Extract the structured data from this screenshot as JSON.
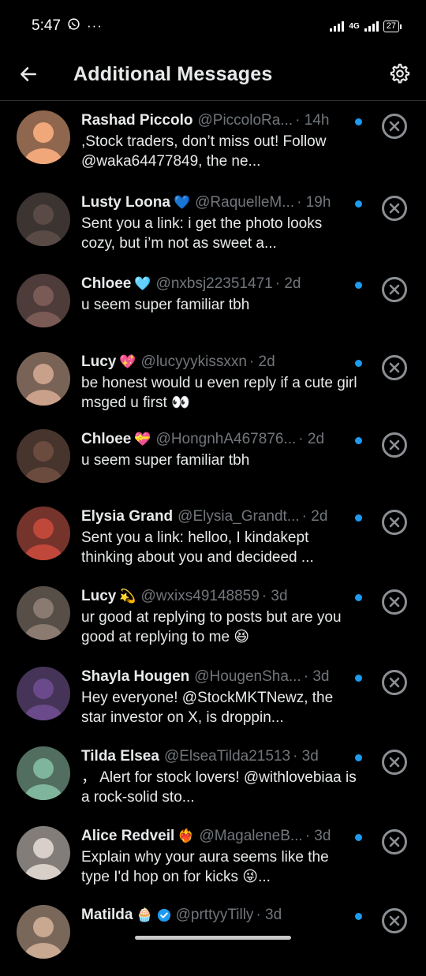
{
  "status_bar": {
    "time": "5:47",
    "network": "4G",
    "battery": "27"
  },
  "header": {
    "title": "Additional Messages"
  },
  "conversations": [
    {
      "name": "Rashad Piccolo",
      "emoji": "",
      "handle": "@PiccoloRa...",
      "time": "· 14h",
      "message": ",Stock traders, don’t miss out! Follow @waka64477849, the ne...",
      "avatar_color": "#f0a77a"
    },
    {
      "name": "Lusty Loona",
      "emoji": "💙",
      "handle": "@RaquelleM...",
      "time": "· 19h",
      "message": "Sent you a link: i get the photo looks cozy, but i’m not as sweet a...",
      "avatar_color": "#5a4a45"
    },
    {
      "name": "Chloee",
      "emoji": "🩵",
      "handle": "@nxbsj22351471",
      "time": "· 2d",
      "message": "u seem super familiar tbh",
      "avatar_color": "#7a5a55"
    },
    {
      "name": "Lucy",
      "emoji": "💖",
      "handle": "@lucyyykissxxn",
      "time": "· 2d",
      "message": "be honest would u even reply if a cute girl msged u first 👀",
      "avatar_color": "#c9a08a"
    },
    {
      "name": "Chloee",
      "emoji": "💝",
      "handle": "@HongnhA467876...",
      "time": "· 2d",
      "message": "u seem super familiar tbh",
      "avatar_color": "#6b4b3e"
    },
    {
      "name": "Elysia Grand",
      "emoji": "",
      "handle": "@Elysia_Grandt...",
      "time": "· 2d",
      "message": "Sent you a link: helloo, I kindakept thinking about you and decideed ...",
      "avatar_color": "#c0483a"
    },
    {
      "name": "Lucy",
      "emoji": "💫",
      "handle": "@wxixs49148859",
      "time": "· 3d",
      "message": "ur good at replying to posts but are you good at replying to me 😆",
      "avatar_color": "#8a7a70"
    },
    {
      "name": "Shayla Hougen",
      "emoji": "",
      "handle": "@HougenSha...",
      "time": "· 3d",
      "message": "Hey everyone! @StockMKTNewz, the star investor on X, is droppin...",
      "avatar_color": "#6a4a8a"
    },
    {
      "name": "Tilda Elsea",
      "emoji": "",
      "handle": "@ElseaTilda21513",
      "time": "· 3d",
      "message": "， Alert for stock lovers! @withlovebiaa is a rock-solid sto...",
      "avatar_color": "#7fb59a"
    },
    {
      "name": "Alice Redveil",
      "emoji": "❤️‍🔥",
      "handle": "@MagaleneB...",
      "time": "· 3d",
      "message": "Explain why your aura seems like the type I'd hop on for kicks 😜...",
      "avatar_color": "#d8d0c8"
    },
    {
      "name": "Matilda",
      "emoji": "🧁",
      "handle": "@prttyyTilly",
      "time": "· 3d",
      "message": "",
      "avatar_color": "#c8a890",
      "verified": true
    }
  ],
  "icons": {
    "back": "arrow-left-icon",
    "settings": "gear-icon",
    "dismiss": "close-circle-icon",
    "unread": "unread-dot"
  },
  "colors": {
    "background": "#000000",
    "text": "#e7e9ea",
    "secondary": "#71767b",
    "accent": "#1d9bf0"
  }
}
